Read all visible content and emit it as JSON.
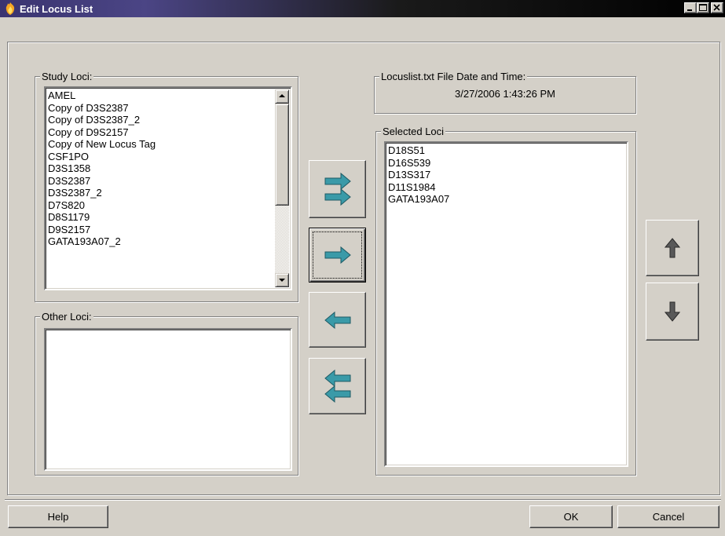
{
  "window": {
    "title": "Edit Locus List",
    "app_icon": "flame-icon",
    "controls": [
      "minimize-icon",
      "maximize-icon",
      "close-icon"
    ]
  },
  "study_loci": {
    "label": "Study Loci:",
    "items": [
      "AMEL",
      "Copy of D3S2387",
      "Copy of D3S2387_2",
      "Copy of D9S2157",
      "Copy of New Locus Tag",
      "CSF1PO",
      "D3S1358",
      "D3S2387",
      "D3S2387_2",
      "D7S820",
      "D8S1179",
      "D9S2157",
      "GATA193A07_2"
    ]
  },
  "other_loci": {
    "label": "Other Loci:",
    "items": []
  },
  "file_info": {
    "label": "Locuslist.txt File Date and Time:",
    "value": "3/27/2006 1:43:26 PM"
  },
  "selected_loci": {
    "label": "Selected Loci",
    "items": [
      "D18S51",
      "D16S539",
      "D13S317",
      "D11S1984",
      "GATA193A07"
    ]
  },
  "transfer_buttons": {
    "add_all": "double-right-arrow-icon",
    "add_one": "right-arrow-icon",
    "remove_one": "left-arrow-icon",
    "remove_all": "double-left-arrow-icon"
  },
  "order_buttons": {
    "move_up": "up-arrow-icon",
    "move_down": "down-arrow-icon"
  },
  "footer": {
    "help_label": "Help",
    "ok_label": "OK",
    "cancel_label": "Cancel"
  },
  "colors": {
    "dialog_bg": "#d4d0c8",
    "arrow_teal": "#3a9aa8",
    "title_start": "#3a3470"
  }
}
